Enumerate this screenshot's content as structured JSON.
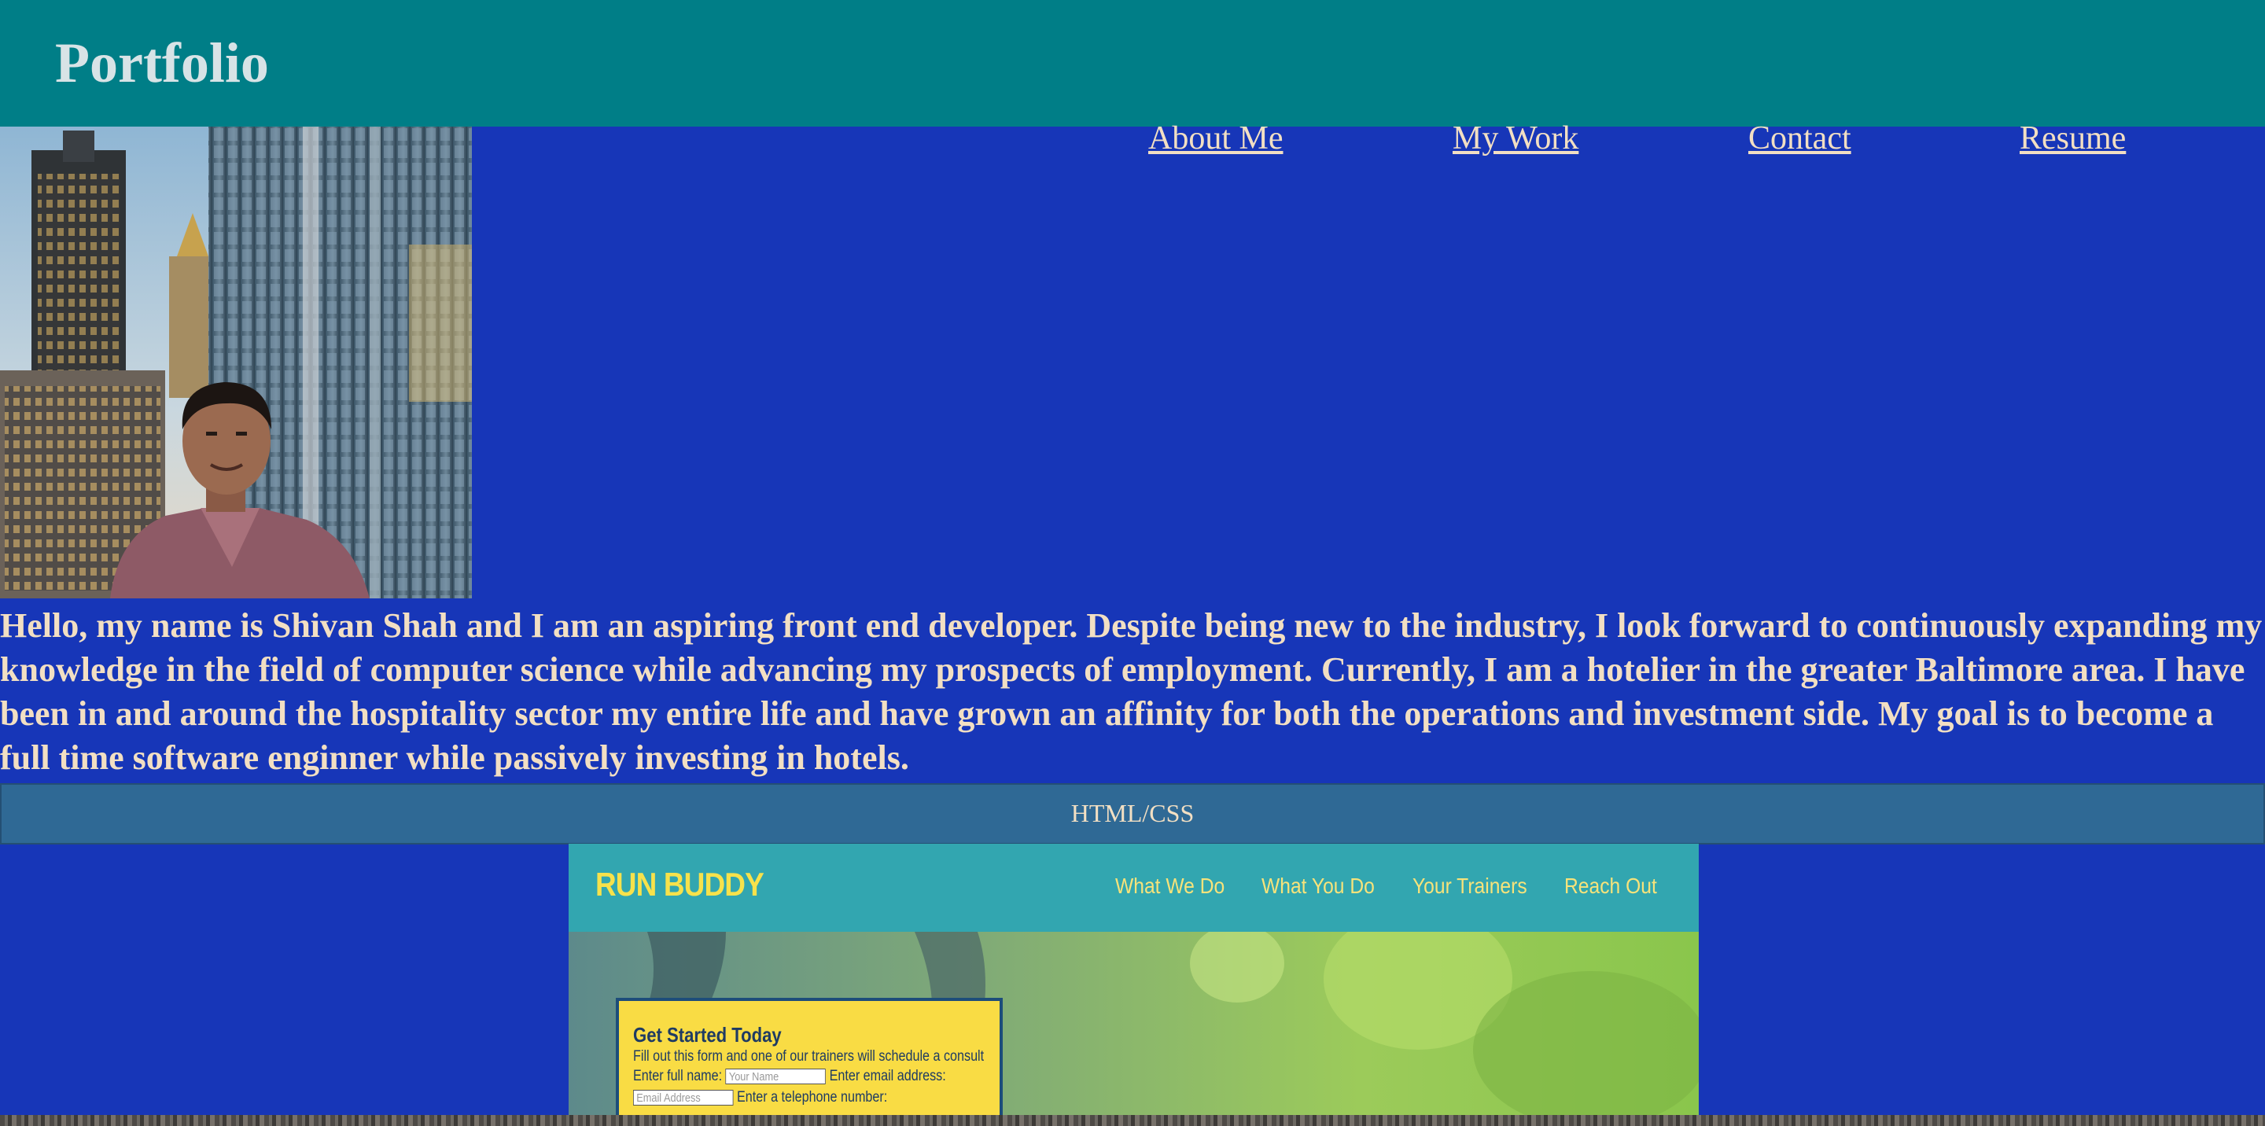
{
  "header": {
    "title": "Portfolio",
    "background": "#007e87"
  },
  "nav": {
    "items": [
      {
        "label": "About Me"
      },
      {
        "label": "My Work"
      },
      {
        "label": "Contact"
      },
      {
        "label": "Resume"
      }
    ]
  },
  "profile": {
    "photo_icon": "profile-photo"
  },
  "bio": {
    "text": "Hello, my name is Shivan Shah and I am an aspiring front end developer. Despite being new to the industry, I look forward to continuously expanding my knowledge in the field of computer science while advancing my prospects of employment. Currently, I am a hotelier in the greater Baltimore area. I have been in and around the hospitality sector my entire life and have grown an affinity for both the operations and investment side. My goal is to become a full time software enginner while passively investing in hotels."
  },
  "work": {
    "section_label": "HTML/CSS",
    "project": {
      "logo": "RUN BUDDY",
      "nav": [
        "What We Do",
        "What You Do",
        "Your Trainers",
        "Reach Out"
      ],
      "form": {
        "title": "Get Started Today",
        "subtitle": "Fill out this form and one of our trainers will schedule a consult",
        "name_label": "Enter full name:",
        "name_placeholder": "Your Name",
        "email_label": "Enter email address:",
        "email_placeholder": "Email Address",
        "phone_label": "Enter a telephone number:"
      }
    }
  },
  "colors": {
    "page_background": "#1736b8",
    "text": "#f2dfc3",
    "section_band": "#2f6995",
    "run_buddy_teal": "#32a6b0",
    "run_buddy_yellow": "#f9dc44"
  }
}
